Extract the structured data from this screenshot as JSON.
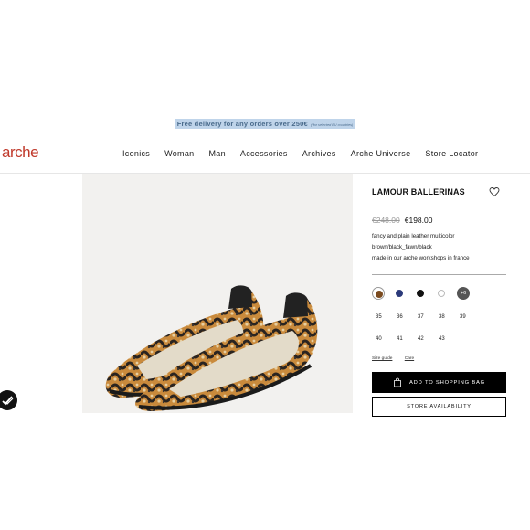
{
  "promo": {
    "main": "Free delivery for any orders over 250€",
    "note": "(*for selected EU countries)"
  },
  "brand": {
    "logo": "arche"
  },
  "nav": {
    "items": [
      "Iconics",
      "Woman",
      "Man",
      "Accessories",
      "Archives",
      "Arche Universe",
      "Store Locator"
    ]
  },
  "product": {
    "name": "LAMOUR BALLERINAS",
    "old_price": "€248.00",
    "price": "€198.00",
    "description": [
      "fancy and plain leather multicolor",
      "brown/black_fawn/black",
      "made in our arche workshops in france"
    ],
    "colors": [
      "#7a4a1e",
      "#2b3a7a",
      "#111111",
      "#ffffff"
    ],
    "more_colors": "+6",
    "sizes": [
      "35",
      "36",
      "37",
      "38",
      "39",
      "40",
      "41",
      "42",
      "43"
    ],
    "size_guide": "Size guide",
    "care": "Care",
    "add_to_bag": "ADD TO SHOPPING BAG",
    "store_availability": "STORE AVAILABILITY"
  },
  "icons": {
    "heart": "heart-icon",
    "bag": "shopping-bag-icon",
    "badge": "checkmark-badge-icon"
  }
}
